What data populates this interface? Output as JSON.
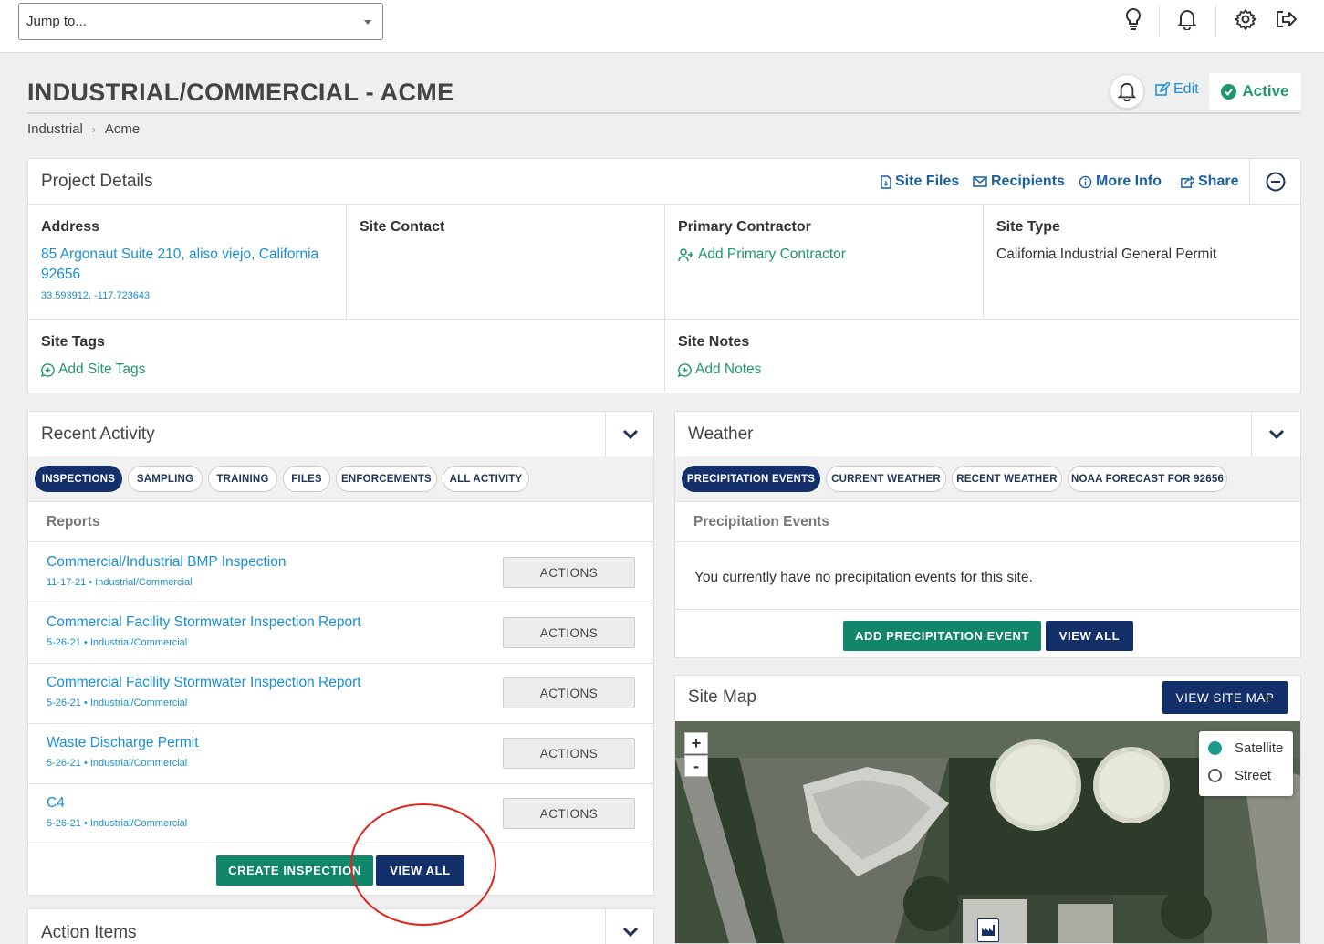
{
  "topbar": {
    "jump_placeholder": "Jump to..."
  },
  "header": {
    "title": "INDUSTRIAL/COMMERCIAL - ACME",
    "edit_label": "Edit",
    "status_label": "Active",
    "breadcrumb": [
      "Industrial",
      "Acme"
    ]
  },
  "project": {
    "title": "Project Details",
    "links": [
      "Site Files",
      "Recipients",
      "More Info",
      "Share"
    ],
    "address_label": "Address",
    "address_value": "85 Argonaut Suite 210, aliso viejo, California 92656",
    "coords": "33.593912, -117.723643",
    "site_contact_label": "Site Contact",
    "primary_contractor_label": "Primary Contractor",
    "add_primary_contractor": "Add Primary Contractor",
    "site_type_label": "Site Type",
    "site_type_value": "California Industrial General Permit",
    "site_tags_label": "Site Tags",
    "add_site_tags": "Add Site Tags",
    "site_notes_label": "Site Notes",
    "add_notes": "Add Notes"
  },
  "recent": {
    "title": "Recent Activity",
    "tabs": [
      "INSPECTIONS",
      "SAMPLING",
      "TRAINING",
      "FILES",
      "ENFORCEMENTS",
      "ALL ACTIVITY"
    ],
    "active_tab": "INSPECTIONS",
    "section_label": "Reports",
    "actions_label": "ACTIONS",
    "rows": [
      {
        "title": "Commercial/Industrial BMP Inspection",
        "meta": "11-17-21 • Industrial/Commercial"
      },
      {
        "title": "Commercial Facility Stormwater Inspection Report",
        "meta": "5-26-21 • Industrial/Commercial"
      },
      {
        "title": "Commercial Facility Stormwater Inspection Report",
        "meta": "5-26-21 • Industrial/Commercial"
      },
      {
        "title": "Waste Discharge Permit",
        "meta": "5-26-21 • Industrial/Commercial"
      },
      {
        "title": "C4",
        "meta": "5-26-21 • Industrial/Commercial"
      }
    ],
    "create_label": "CREATE INSPECTION",
    "view_all_label": "VIEW ALL"
  },
  "action_items": {
    "title": "Action Items"
  },
  "weather": {
    "title": "Weather",
    "tabs": [
      "PRECIPITATION EVENTS",
      "CURRENT WEATHER",
      "RECENT WEATHER",
      "NOAA FORECAST FOR 92656"
    ],
    "active_tab": "PRECIPITATION EVENTS",
    "section_label": "Precipitation Events",
    "empty_message": "You currently have no precipitation events for this site.",
    "add_label": "ADD PRECIPITATION EVENT",
    "view_all_label": "VIEW ALL"
  },
  "site_map": {
    "title": "Site Map",
    "view_label": "VIEW SITE MAP",
    "zoom_in": "+",
    "zoom_out": "-",
    "layers": [
      "Satellite",
      "Street"
    ],
    "selected_layer": "Satellite"
  },
  "colors": {
    "navy": "#13306b",
    "green": "#12866a",
    "link": "#1a8fd1",
    "annotation": "#e0231c"
  }
}
